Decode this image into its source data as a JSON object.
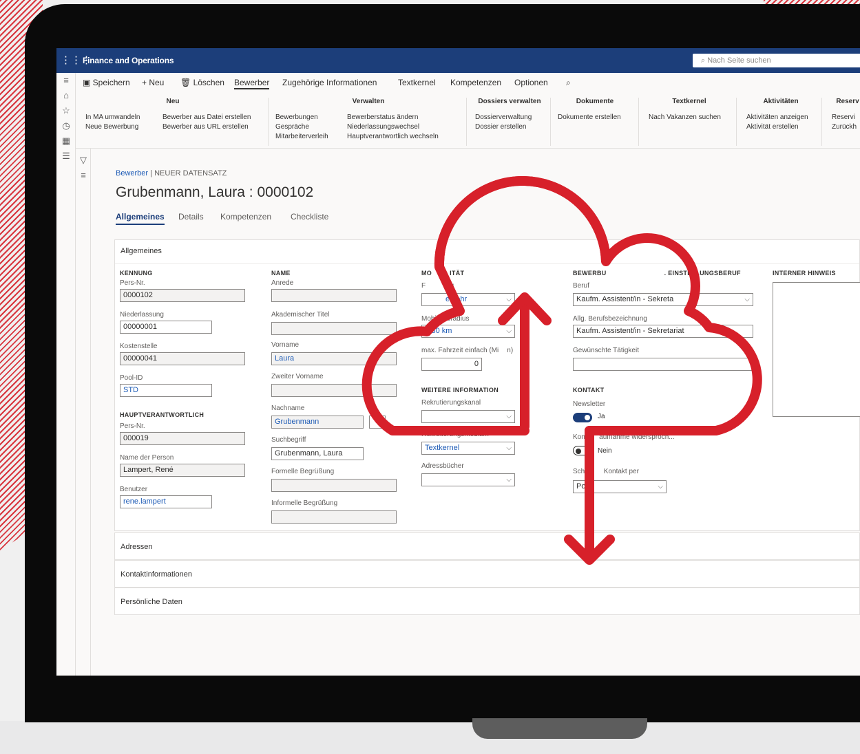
{
  "app": {
    "title": "Finance and Operations",
    "search_placeholder": "Nach Seite suchen"
  },
  "actions": [
    "Speichern",
    "Neu",
    "Löschen",
    "Bewerber",
    "Zugehörige Informationen",
    "Textkernel",
    "Kompetenzen",
    "Optionen"
  ],
  "ribbon": {
    "neu": {
      "title": "Neu",
      "col1": [
        "In MA umwandeln",
        "Neue Bewerbung"
      ],
      "col2": [
        "Bewerber aus Datei erstellen",
        "Bewerber aus URL erstellen"
      ]
    },
    "verwalten": {
      "title": "Verwalten",
      "col1": [
        "Bewerbungen",
        "Gespräche",
        "Mitarbeiterverleih"
      ],
      "col2": [
        "Bewerberstatus ändern",
        "Niederlassungswechsel",
        "Hauptverantwortlich wechseln"
      ]
    },
    "dossiers": {
      "title": "Dossiers verwalten",
      "items": [
        "Dossierverwaltung",
        "Dossier erstellen"
      ]
    },
    "dokumente": {
      "title": "Dokumente",
      "items": [
        "Dokumente erstellen"
      ]
    },
    "textkernel": {
      "title": "Textkernel",
      "items": [
        "Nach Vakanzen suchen"
      ]
    },
    "aktivitaeten": {
      "title": "Aktivitäten",
      "items": [
        "Aktivitäten anzeigen",
        "Aktivität erstellen"
      ]
    },
    "reserv": {
      "title": "Reserv",
      "items": [
        "Reservi",
        "Zurückh"
      ]
    }
  },
  "breadcrumb": {
    "link": "Bewerber",
    "sep": "|",
    "current": "NEUER DATENSATZ"
  },
  "record_title": "Grubenmann, Laura : 0000102",
  "tabs": [
    "Allgemeines",
    "Details",
    "Kompetenzen",
    "Checkliste"
  ],
  "fasttab_title": "Allgemeines",
  "kennung": {
    "title": "KENNUNG",
    "pers_nr_label": "Pers-Nr.",
    "pers_nr": "0000102",
    "niederlassung_label": "Niederlassung",
    "niederlassung": "00000001",
    "kostenstelle_label": "Kostenstelle",
    "kostenstelle": "00000041",
    "pool_label": "Pool-ID",
    "pool": "STD"
  },
  "haupt": {
    "title": "HAUPTVERANTWORTLICH",
    "pers_nr_label": "Pers-Nr.",
    "pers_nr": "000019",
    "name_label": "Name der Person",
    "name": "Lampert, René",
    "benutzer_label": "Benutzer",
    "benutzer": "rene.lampert"
  },
  "name": {
    "title": "NAME",
    "anrede_label": "Anrede",
    "anrede": "",
    "titel_label": "Akademischer Titel",
    "titel": "",
    "vorname_label": "Vorname",
    "vorname": "Laura",
    "zweiter_label": "Zweiter Vorname",
    "zweiter": "",
    "nachname_label": "Nachname",
    "nachname": "Grubenmann",
    "such_label": "Suchbegriff",
    "such": "Grubenmann, Laura",
    "formell_label": "Formelle Begrüßung",
    "formell": "",
    "informell_label": "Informelle Begrüßung",
    "informell": ""
  },
  "mobil": {
    "title": "MO",
    "title2": "ITÄT",
    "fahr_label_a": "F",
    "fahr_label_b": "ug",
    "fahr_value": "erkehr",
    "radius_label": "Mobilitätsradius",
    "radius": "< 30 km",
    "zeit_label_a": "max. Fahrzeit einfach (Mi",
    "zeit_label_b": "n)",
    "zeit": "0"
  },
  "weitere": {
    "title": "WEITERE INFORMATION",
    "kanal_label": "Rekrutierungskanal",
    "kanal": "",
    "medium_label": "Rekrutierungsmedium",
    "medium": "Textkernel",
    "adress_label": "Adressbücher",
    "adress": ""
  },
  "beruf": {
    "title_a": "BEWERBU",
    "title_b": ". EINSTELLUNGSBERUF",
    "beruf_label": "Beruf",
    "beruf": "Kaufm. Assistent/in - Sekreta",
    "bez_label": "Allg. Berufsbezeichnung",
    "bez": "Kaufm. Assistent/in - Sekretariat",
    "taetig_label": "Gewünschte Tätigkeit",
    "taetig": ""
  },
  "kontakt": {
    "title": "KONTAKT",
    "newsletter_label": "Newsletter",
    "newsletter": "Ja",
    "widerspruch_label_a": "Konta",
    "widerspruch_label_b": "aufnahme widersproch...",
    "widerspruch": "Nein",
    "per_label_a": "Schri",
    "per_label_b": "Kontakt per",
    "per": "Post"
  },
  "intern": {
    "title": "INTERNER HINWEIS"
  },
  "collapsed": [
    "Adressen",
    "Kontaktinformationen",
    "Persönliche Daten"
  ],
  "colors": {
    "topbar": "#1c3e7a",
    "accent": "#d7202a"
  }
}
